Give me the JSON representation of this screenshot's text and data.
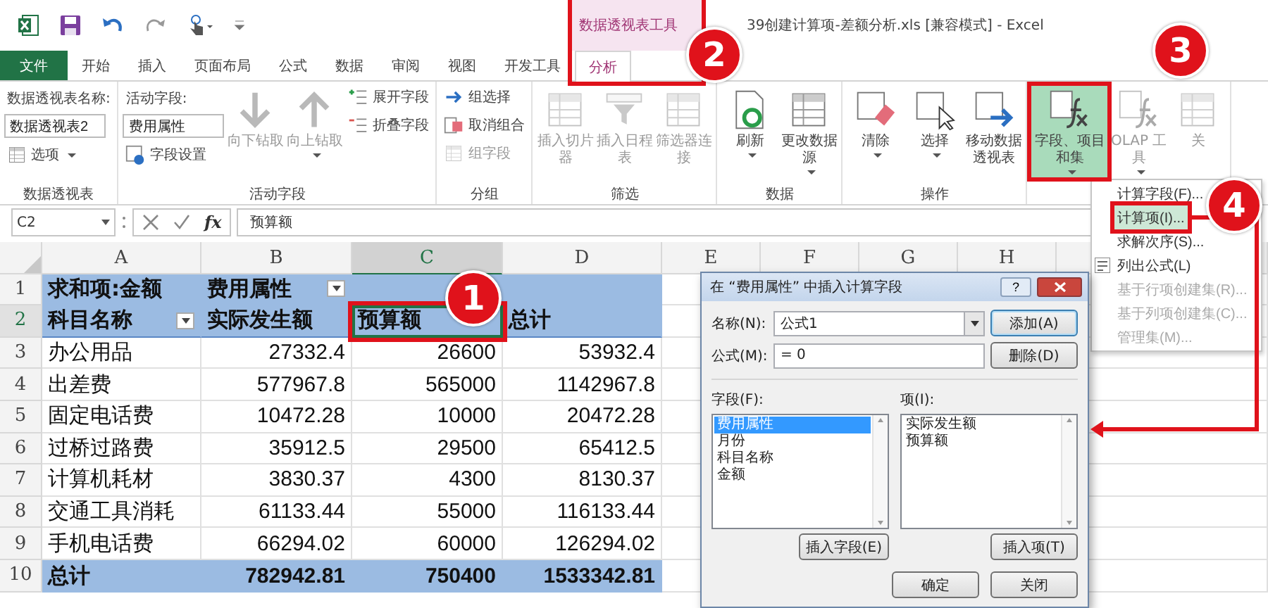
{
  "title_bar": {
    "context_tab": "数据透视表工具",
    "title": "39创建计算项-差额分析.xls  [兼容模式] - Excel"
  },
  "tabs": [
    {
      "label": "文件",
      "kind": "file",
      "selected": false
    },
    {
      "label": "开始",
      "kind": "normal",
      "selected": false
    },
    {
      "label": "插入",
      "kind": "normal",
      "selected": false
    },
    {
      "label": "页面布局",
      "kind": "normal",
      "selected": false
    },
    {
      "label": "公式",
      "kind": "normal",
      "selected": false
    },
    {
      "label": "数据",
      "kind": "normal",
      "selected": false
    },
    {
      "label": "审阅",
      "kind": "normal",
      "selected": false
    },
    {
      "label": "视图",
      "kind": "normal",
      "selected": false
    },
    {
      "label": "开发工具",
      "kind": "normal",
      "selected": false
    },
    {
      "label": "分析",
      "kind": "context",
      "selected": true
    }
  ],
  "ribbon": {
    "groups": [
      {
        "label": "数据透视表",
        "columns": [
          [
            {
              "kind": "label",
              "text": "数据透视表名称:"
            },
            {
              "kind": "field",
              "value": "数据透视表2"
            },
            {
              "kind": "small",
              "text": "选项",
              "dropdown": true,
              "disabled": false
            }
          ]
        ]
      },
      {
        "label": "活动字段",
        "columns": [
          [
            {
              "kind": "label",
              "text": "活动字段:"
            },
            {
              "kind": "field",
              "value": "费用属性"
            },
            {
              "kind": "small",
              "text": "字段设置",
              "dropdown": false,
              "disabled": false
            }
          ],
          [
            {
              "kind": "large",
              "text": "向下钻取",
              "dropdown": false,
              "disabled": true
            }
          ],
          [
            {
              "kind": "large",
              "text": "向上钻取",
              "dropdown": true,
              "disabled": true
            }
          ],
          [
            {
              "kind": "small",
              "text": "展开字段",
              "dropdown": false,
              "disabled": false
            },
            {
              "kind": "small",
              "text": "折叠字段",
              "dropdown": false,
              "disabled": false
            }
          ]
        ]
      },
      {
        "label": "分组",
        "columns": [
          [
            {
              "kind": "small",
              "text": "组选择",
              "dropdown": false,
              "disabled": false
            },
            {
              "kind": "small",
              "text": "取消组合",
              "dropdown": false,
              "disabled": false
            },
            {
              "kind": "small",
              "text": "组字段",
              "dropdown": false,
              "disabled": true
            }
          ]
        ]
      },
      {
        "label": "筛选",
        "columns": [
          [
            {
              "kind": "large",
              "text": "插入切片器",
              "dropdown": false,
              "disabled": true
            }
          ],
          [
            {
              "kind": "large",
              "text": "插入日程表",
              "dropdown": false,
              "disabled": true
            }
          ],
          [
            {
              "kind": "large",
              "text": "筛选器连接",
              "dropdown": false,
              "disabled": true
            }
          ]
        ]
      },
      {
        "label": "数据",
        "columns": [
          [
            {
              "kind": "large",
              "text": "刷新",
              "dropdown": true,
              "disabled": false
            }
          ],
          [
            {
              "kind": "large",
              "text": "更改数据源",
              "dropdown": true,
              "disabled": false
            }
          ]
        ]
      },
      {
        "label": "操作",
        "columns": [
          [
            {
              "kind": "large",
              "text": "清除",
              "dropdown": true,
              "disabled": false
            }
          ],
          [
            {
              "kind": "large",
              "text": "选择",
              "dropdown": true,
              "disabled": false
            }
          ],
          [
            {
              "kind": "large",
              "text": "移动数据透视表",
              "dropdown": false,
              "disabled": false
            }
          ]
        ]
      },
      {
        "columns": [
          [
            {
              "kind": "large",
              "text": "字段、项目和集",
              "dropdown": true,
              "disabled": false,
              "pressed": true
            }
          ],
          [
            {
              "kind": "large",
              "text": "OLAP 工具",
              "dropdown": true,
              "disabled": true,
              "pressed": false
            }
          ],
          [
            {
              "kind": "large",
              "text": "关",
              "dropdown": false,
              "disabled": true,
              "pressed": false
            }
          ]
        ]
      }
    ]
  },
  "formula_bar": {
    "name_box": "C2",
    "insert_function": "fx",
    "formula": "预算额"
  },
  "sheet": {
    "columns": [
      {
        "label": "A",
        "selected": false
      },
      {
        "label": "B",
        "selected": false
      },
      {
        "label": "C",
        "selected": true
      },
      {
        "label": "D",
        "selected": false
      },
      {
        "label": "E",
        "selected": false
      },
      {
        "label": "F",
        "selected": false
      },
      {
        "label": "G",
        "selected": false
      },
      {
        "label": "H",
        "selected": false
      }
    ],
    "rows": [
      {
        "number": "1",
        "kind": "header",
        "selected": false,
        "cells": [
          {
            "text": "求和项:金额"
          },
          {
            "text": "费用属性",
            "filter": true
          }
        ]
      },
      {
        "number": "2",
        "kind": "header",
        "selected": true,
        "cells": [
          {
            "text": "科目名称",
            "filter": true
          },
          {
            "text": "实际发生额"
          },
          {
            "text": "预算额",
            "selected": true
          },
          {
            "text": "总计"
          }
        ]
      },
      {
        "number": "3",
        "kind": "data",
        "selected": false,
        "cells": [
          {
            "text": "办公用品"
          },
          {
            "text": "27332.4",
            "kind": "number"
          },
          {
            "text": "26600",
            "kind": "number"
          },
          {
            "text": "53932.4",
            "kind": "number"
          }
        ]
      },
      {
        "number": "4",
        "kind": "data",
        "selected": false,
        "cells": [
          {
            "text": "出差费"
          },
          {
            "text": "577967.8",
            "kind": "number"
          },
          {
            "text": "565000",
            "kind": "number"
          },
          {
            "text": "1142967.8",
            "kind": "number"
          }
        ]
      },
      {
        "number": "5",
        "kind": "data",
        "selected": false,
        "cells": [
          {
            "text": "固定电话费"
          },
          {
            "text": "10472.28",
            "kind": "number"
          },
          {
            "text": "10000",
            "kind": "number"
          },
          {
            "text": "20472.28",
            "kind": "number"
          }
        ]
      },
      {
        "number": "6",
        "kind": "data",
        "selected": false,
        "cells": [
          {
            "text": "过桥过路费"
          },
          {
            "text": "35912.5",
            "kind": "number"
          },
          {
            "text": "29500",
            "kind": "number"
          },
          {
            "text": "65412.5",
            "kind": "number"
          }
        ]
      },
      {
        "number": "7",
        "kind": "data",
        "selected": false,
        "cells": [
          {
            "text": "计算机耗材"
          },
          {
            "text": "3830.37",
            "kind": "number"
          },
          {
            "text": "4300",
            "kind": "number"
          },
          {
            "text": "8130.37",
            "kind": "number"
          }
        ]
      },
      {
        "number": "8",
        "kind": "data",
        "selected": false,
        "cells": [
          {
            "text": "交通工具消耗"
          },
          {
            "text": "61133.44",
            "kind": "number"
          },
          {
            "text": "55000",
            "kind": "number"
          },
          {
            "text": "116133.44",
            "kind": "number"
          }
        ]
      },
      {
        "number": "9",
        "kind": "data",
        "selected": false,
        "cells": [
          {
            "text": "手机电话费"
          },
          {
            "text": "66294.02",
            "kind": "number"
          },
          {
            "text": "60000",
            "kind": "number"
          },
          {
            "text": "126294.02",
            "kind": "number"
          }
        ]
      },
      {
        "number": "10",
        "kind": "total",
        "selected": false,
        "cells": [
          {
            "text": "总计"
          },
          {
            "text": "782942.81",
            "kind": "number"
          },
          {
            "text": "750400",
            "kind": "number"
          },
          {
            "text": "1533342.81",
            "kind": "number"
          }
        ]
      }
    ]
  },
  "menu": {
    "items": [
      {
        "label": "计算字段(F)...",
        "selected": false,
        "disabled": false
      },
      {
        "label": "计算项(I)...",
        "selected": true,
        "disabled": false
      },
      {
        "label": "求解次序(S)...",
        "selected": false,
        "disabled": false
      },
      {
        "label": "列出公式(L)",
        "selected": false,
        "disabled": false
      },
      {
        "label": "基于行项创建集(R)...",
        "selected": false,
        "disabled": true
      },
      {
        "label": "基于列项创建集(C)...",
        "selected": false,
        "disabled": true
      },
      {
        "label": "管理集(M)...",
        "selected": false,
        "disabled": true
      }
    ]
  },
  "dialog": {
    "title": "在 “费用属性” 中插入计算字段",
    "help": "?",
    "name_label": "名称(N):",
    "name_value": "公式1",
    "add_button": "添加(A)",
    "formula_label": "公式(M):",
    "formula_value": "= 0",
    "delete_button": "删除(D)",
    "fields_label": "字段(F):",
    "fields": [
      {
        "label": "费用属性",
        "selected": true
      },
      {
        "label": "月份",
        "selected": false
      },
      {
        "label": "科目名称",
        "selected": false
      },
      {
        "label": "金额",
        "selected": false
      }
    ],
    "items_label": "项(I):",
    "items": [
      {
        "label": "实际发生额",
        "selected": false
      },
      {
        "label": "预算额",
        "selected": false
      }
    ],
    "insert_field_button": "插入字段(E)",
    "insert_item_button": "插入项(T)",
    "ok_button": "确定",
    "close_button": "关闭"
  },
  "callouts": [
    "1",
    "2",
    "3",
    "4"
  ]
}
